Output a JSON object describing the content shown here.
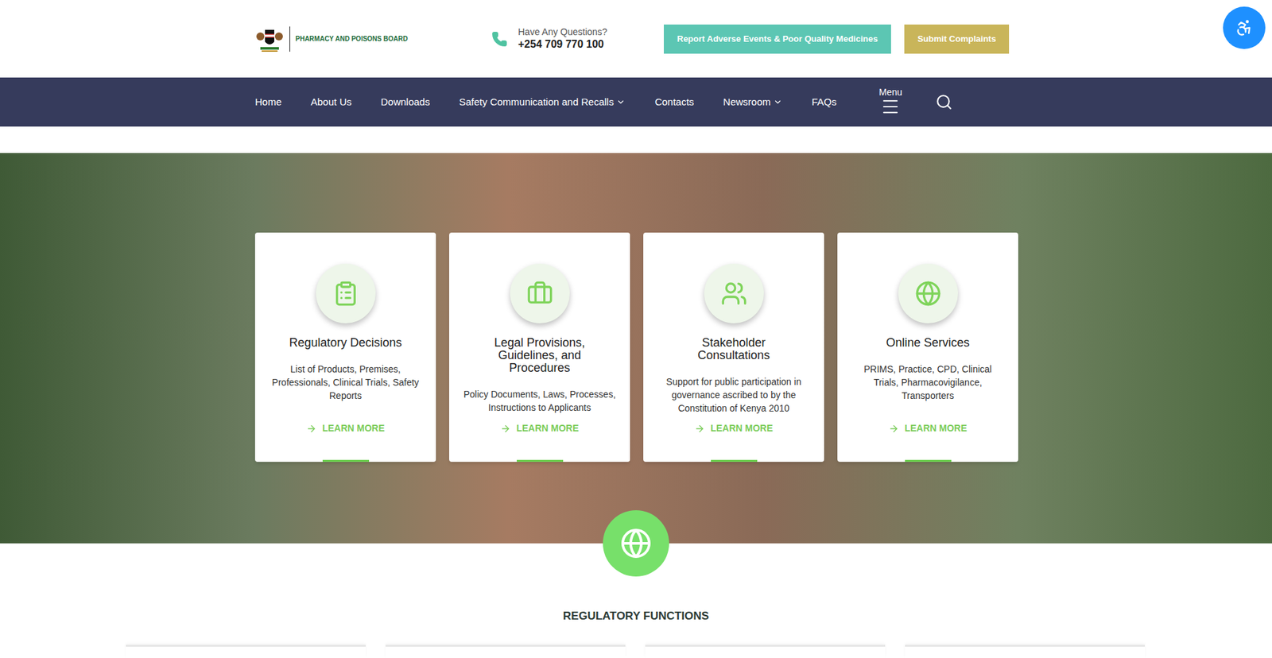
{
  "header": {
    "logo_text": "PHARMACY AND POISONS BOARD",
    "contact_label": "Have Any Questions?",
    "contact_phone": "+254 709 770 100",
    "buttons": [
      "Report Adverse Events & Poor Quality Medicines",
      "Submit Complaints"
    ]
  },
  "nav": {
    "items": [
      {
        "label": "Home",
        "dropdown": false
      },
      {
        "label": "About Us",
        "dropdown": false
      },
      {
        "label": "Downloads",
        "dropdown": false
      },
      {
        "label": "Safety Communication and Recalls",
        "dropdown": true
      },
      {
        "label": "Contacts",
        "dropdown": false
      },
      {
        "label": "Newsroom",
        "dropdown": true
      },
      {
        "label": "FAQs",
        "dropdown": false
      }
    ],
    "menu_label": "Menu"
  },
  "cards": [
    {
      "title": "Regulatory Decisions",
      "description": "List of Products, Premises, Professionals, Clinical Trials, Safety Reports",
      "link": "LEARN MORE"
    },
    {
      "title": "Legal Provisions, Guidelines, and Procedures",
      "description": "Policy Documents, Laws, Processes, Instructions to Applicants",
      "link": "LEARN MORE"
    },
    {
      "title": "Stakeholder Consultations",
      "description": "Support for public participation in governance ascribed to by the Constitution of Kenya 2010",
      "link": "LEARN MORE"
    },
    {
      "title": "Online Services",
      "description": "PRIMS, Practice, CPD, Clinical Trials, Pharmacovigilance, Transporters",
      "link": "LEARN MORE"
    }
  ],
  "section": {
    "title": "REGULATORY FUNCTIONS"
  }
}
